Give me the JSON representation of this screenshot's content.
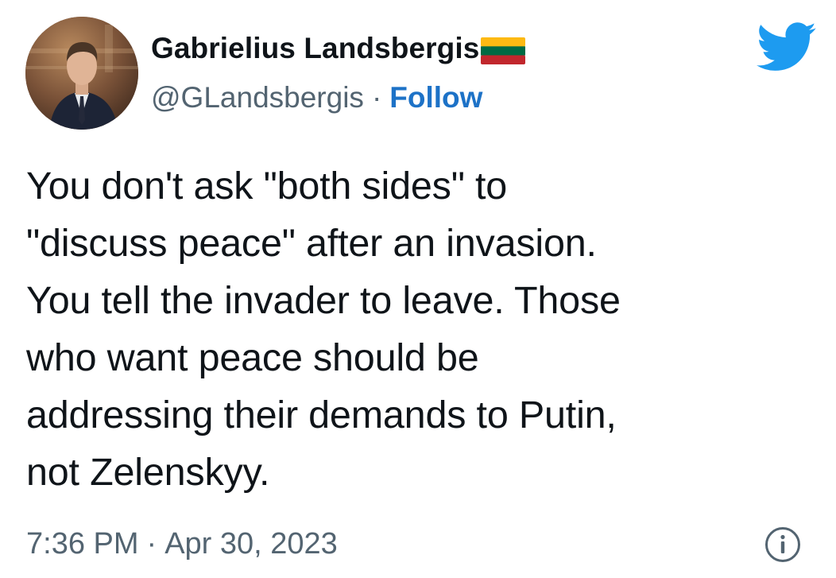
{
  "author": {
    "name": "Gabrielius Landsbergis",
    "handle": "@GLandsbergis",
    "separator": "·",
    "follow_label": "Follow",
    "flag": "lithuania-flag"
  },
  "tweet": {
    "text": "You don't ask \"both sides\" to\n\"discuss peace\" after an invasion.\nYou tell the invader to leave. Those\nwho want peace should be\naddressing their demands to Putin,\nnot Zelenskyy."
  },
  "meta": {
    "time": "7:36 PM",
    "separator": "·",
    "date": "Apr 30, 2023"
  },
  "icons": {
    "logo": "twitter-bird-icon",
    "info": "info-icon"
  },
  "colors": {
    "follow": "#1d72c7",
    "twitter_blue": "#1d9bf0",
    "muted": "#536471",
    "text": "#0f1419",
    "flag_yellow": "#fdb913",
    "flag_green": "#006a44",
    "flag_red": "#c1272d"
  }
}
